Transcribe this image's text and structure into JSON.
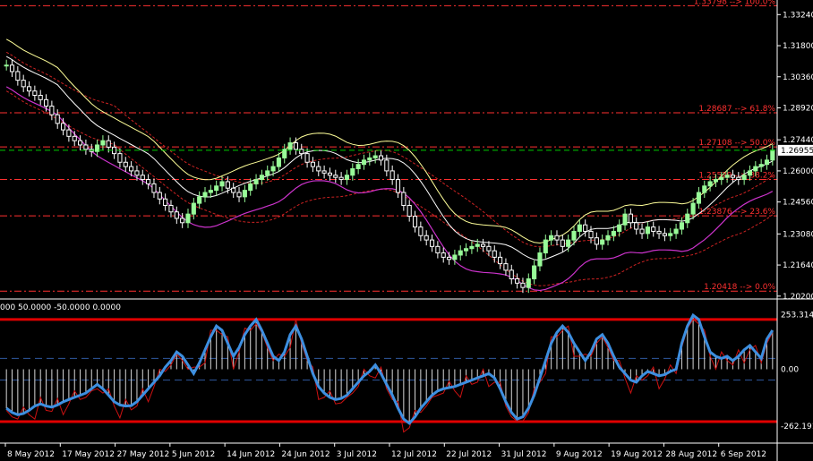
{
  "chart_data": [
    {
      "type": "candlestick",
      "title": "",
      "ylim": [
        1.2015,
        1.3375
      ],
      "price_ticks": [
        "1.33240",
        "1.31800",
        "1.30360",
        "1.28920",
        "1.27440",
        "1.26000",
        "1.24560",
        "1.23080",
        "1.21640",
        "1.20200"
      ],
      "current_price": "1.26955",
      "fib_levels": [
        {
          "label": "1.33798 --> 100.0%",
          "value": 1.3365
        },
        {
          "label": "1.28687 --> 61.8%",
          "value": 1.2869
        },
        {
          "label": "1.27108 --> 50.0%",
          "value": 1.2711
        },
        {
          "label": "1.25529 --> 38.2%",
          "value": 1.256
        },
        {
          "label": "1.23876 --> 23.6%",
          "value": 1.2392
        },
        {
          "label": "1.20418 --> 0.0%",
          "value": 1.2043
        }
      ],
      "close": [
        1.309,
        1.306,
        1.302,
        1.299,
        1.297,
        1.295,
        1.293,
        1.29,
        1.286,
        1.282,
        1.279,
        1.276,
        1.274,
        1.272,
        1.27,
        1.269,
        1.272,
        1.274,
        1.271,
        1.268,
        1.264,
        1.262,
        1.26,
        1.258,
        1.256,
        1.254,
        1.25,
        1.247,
        1.244,
        1.241,
        1.238,
        1.236,
        1.24,
        1.245,
        1.248,
        1.25,
        1.251,
        1.253,
        1.255,
        1.252,
        1.25,
        1.248,
        1.251,
        1.254,
        1.256,
        1.258,
        1.26,
        1.262,
        1.266,
        1.27,
        1.273,
        1.27,
        1.268,
        1.264,
        1.262,
        1.26,
        1.259,
        1.258,
        1.257,
        1.256,
        1.258,
        1.261,
        1.263,
        1.265,
        1.266,
        1.267,
        1.265,
        1.26,
        1.256,
        1.25,
        1.244,
        1.239,
        1.234,
        1.23,
        1.228,
        1.225,
        1.222,
        1.22,
        1.219,
        1.221,
        1.223,
        1.224,
        1.225,
        1.226,
        1.225,
        1.223,
        1.22,
        1.217,
        1.214,
        1.21,
        1.208,
        1.206,
        1.21,
        1.216,
        1.222,
        1.228,
        1.23,
        1.228,
        1.225,
        1.228,
        1.232,
        1.235,
        1.232,
        1.229,
        1.226,
        1.228,
        1.23,
        1.232,
        1.235,
        1.24,
        1.236,
        1.233,
        1.231,
        1.234,
        1.232,
        1.231,
        1.23,
        1.231,
        1.233,
        1.236,
        1.24,
        1.245,
        1.25,
        1.253,
        1.255,
        1.256,
        1.257,
        1.258,
        1.257,
        1.256,
        1.258,
        1.26,
        1.262,
        1.263,
        1.265,
        1.2696
      ],
      "oscillator": {
        "header": "000 50.0000 -50.0000 0.0000",
        "ticks": [
          "253.3140",
          "0.00",
          "-262.1910"
        ],
        "ylim": [
          -300,
          300
        ],
        "upper_line": 230,
        "lower_line": -242,
        "dashed_levels": [
          50,
          -50
        ],
        "main_line": [
          -180,
          -200,
          -210,
          -205,
          -190,
          -170,
          -160,
          -170,
          -175,
          -165,
          -150,
          -140,
          -130,
          -120,
          -110,
          -90,
          -70,
          -90,
          -120,
          -150,
          -165,
          -170,
          -168,
          -150,
          -120,
          -90,
          -60,
          -30,
          10,
          40,
          80,
          60,
          20,
          -20,
          30,
          90,
          150,
          200,
          180,
          120,
          60,
          100,
          160,
          200,
          230,
          180,
          120,
          60,
          40,
          80,
          160,
          200,
          140,
          60,
          -20,
          -80,
          -110,
          -130,
          -140,
          -135,
          -120,
          -90,
          -60,
          -30,
          -10,
          20,
          -20,
          -70,
          -120,
          -180,
          -230,
          -250,
          -220,
          -180,
          -150,
          -120,
          -100,
          -90,
          -85,
          -80,
          -70,
          -60,
          -50,
          -40,
          -30,
          -20,
          -40,
          -90,
          -150,
          -200,
          -230,
          -220,
          -180,
          -120,
          -40,
          40,
          120,
          170,
          200,
          170,
          120,
          80,
          40,
          80,
          140,
          160,
          120,
          60,
          10,
          -20,
          -50,
          -60,
          -30,
          -10,
          -20,
          -30,
          -25,
          -10,
          0,
          120,
          200,
          250,
          230,
          150,
          80,
          60,
          50,
          60,
          40,
          60,
          90,
          110,
          80,
          50,
          140,
          180
        ]
      },
      "x_ticks": [
        "8 May 2012",
        "17 May 2012",
        "27 May 2012",
        "5 Jun 2012",
        "14 Jun 2012",
        "24 Jun 2012",
        "3 Jul 2012",
        "12 Jul 2012",
        "22 Jul 2012",
        "31 Jul 2012",
        "9 Aug 2012",
        "19 Aug 2012",
        "28 Aug 2012",
        "6 Sep 2012"
      ],
      "colors": {
        "background": "#000000",
        "bull_candle": "#98fb98",
        "bear_candle": "#ffffff",
        "fib": "#ff3030",
        "ma_yellow": "#ffff99",
        "ma_white": "#ffffff",
        "ma_magenta": "#cc33cc",
        "env_red": "#cc2222",
        "current": "#00cc00",
        "osc_main": "#3d8fe0",
        "osc_signal": "#cc1111",
        "osc_bounds": "#e00000",
        "osc_dashed": "#2f5aa0"
      }
    }
  ]
}
